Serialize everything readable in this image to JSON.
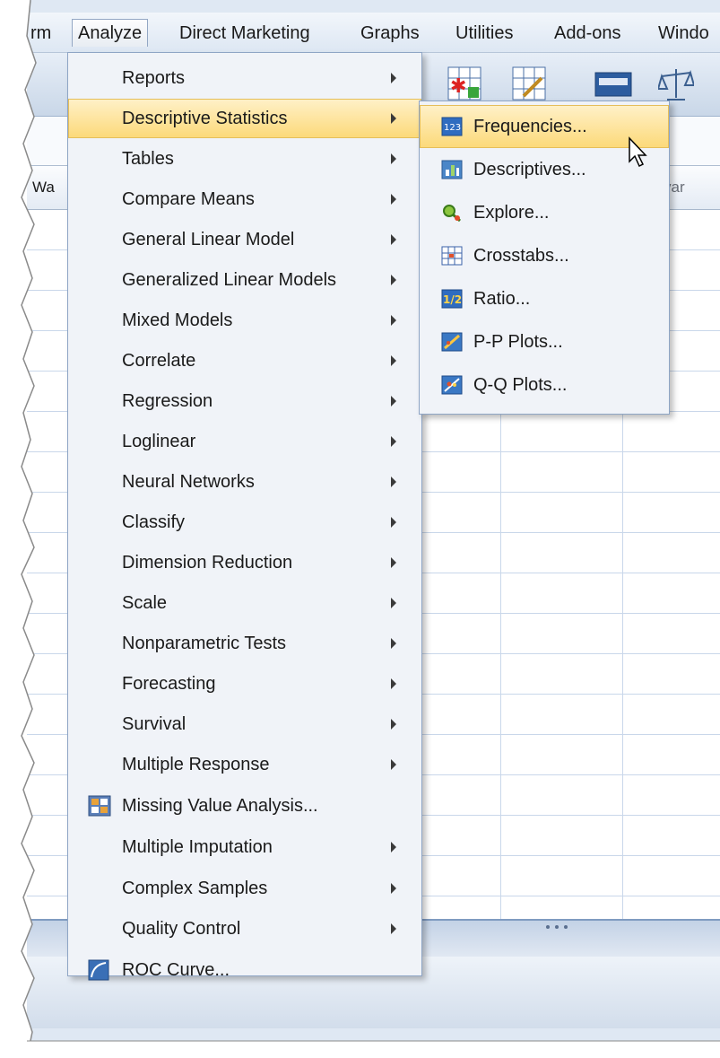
{
  "menubar": {
    "items": [
      "rm",
      "Analyze",
      "Direct Marketing",
      "Graphs",
      "Utilities",
      "Add-ons",
      "Windo"
    ]
  },
  "grid": {
    "col_partial": "Wa",
    "col_var": "var"
  },
  "analyze_menu": {
    "items": [
      {
        "label": "Reports",
        "submenu": true,
        "icon": ""
      },
      {
        "label": "Descriptive Statistics",
        "submenu": true,
        "icon": "",
        "highlighted": true
      },
      {
        "label": "Tables",
        "submenu": true,
        "icon": ""
      },
      {
        "label": "Compare Means",
        "submenu": true,
        "icon": ""
      },
      {
        "label": "General Linear Model",
        "submenu": true,
        "icon": ""
      },
      {
        "label": "Generalized Linear Models",
        "submenu": true,
        "icon": ""
      },
      {
        "label": "Mixed Models",
        "submenu": true,
        "icon": ""
      },
      {
        "label": "Correlate",
        "submenu": true,
        "icon": ""
      },
      {
        "label": "Regression",
        "submenu": true,
        "icon": ""
      },
      {
        "label": "Loglinear",
        "submenu": true,
        "icon": ""
      },
      {
        "label": "Neural Networks",
        "submenu": true,
        "icon": ""
      },
      {
        "label": "Classify",
        "submenu": true,
        "icon": ""
      },
      {
        "label": "Dimension Reduction",
        "submenu": true,
        "icon": ""
      },
      {
        "label": "Scale",
        "submenu": true,
        "icon": ""
      },
      {
        "label": "Nonparametric Tests",
        "submenu": true,
        "icon": ""
      },
      {
        "label": "Forecasting",
        "submenu": true,
        "icon": ""
      },
      {
        "label": "Survival",
        "submenu": true,
        "icon": ""
      },
      {
        "label": "Multiple Response",
        "submenu": true,
        "icon": ""
      },
      {
        "label": "Missing Value Analysis...",
        "submenu": false,
        "icon": "missing-value-icon"
      },
      {
        "label": "Multiple Imputation",
        "submenu": true,
        "icon": ""
      },
      {
        "label": "Complex Samples",
        "submenu": true,
        "icon": ""
      },
      {
        "label": "Quality Control",
        "submenu": true,
        "icon": ""
      },
      {
        "label": "ROC Curve...",
        "submenu": false,
        "icon": "roc-curve-icon"
      }
    ]
  },
  "descriptive_submenu": {
    "items": [
      {
        "label": "Frequencies...",
        "icon": "frequencies-icon",
        "icon_text": "123",
        "highlighted": true
      },
      {
        "label": "Descriptives...",
        "icon": "descriptives-icon"
      },
      {
        "label": "Explore...",
        "icon": "explore-icon"
      },
      {
        "label": "Crosstabs...",
        "icon": "crosstabs-icon"
      },
      {
        "label": "Ratio...",
        "icon": "ratio-icon",
        "icon_text": "1/2"
      },
      {
        "label": "P-P Plots...",
        "icon": "pp-plots-icon"
      },
      {
        "label": "Q-Q Plots...",
        "icon": "qq-plots-icon"
      }
    ]
  },
  "colors": {
    "highlight": "#fcd978",
    "menu_bg": "#f0f3f8",
    "menu_border": "#8ea5c5",
    "grid_line": "#c9d7ea"
  }
}
